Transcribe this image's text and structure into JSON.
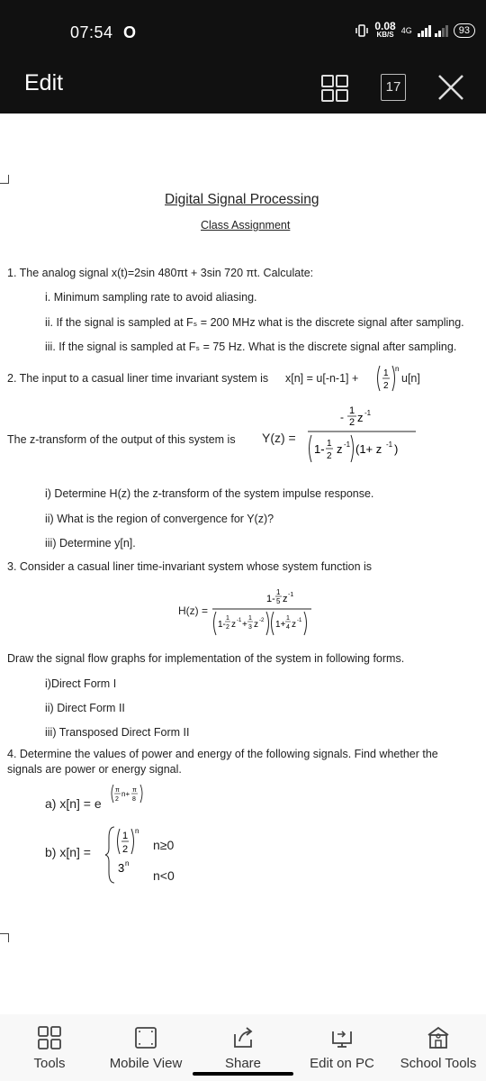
{
  "status": {
    "time": "07:54",
    "indicator": "O",
    "speed_value": "0.08",
    "speed_unit": "KB/S",
    "network": "4G",
    "battery": "93"
  },
  "topbar": {
    "title": "Edit",
    "page_count": "17"
  },
  "doc": {
    "title": "Digital Signal Processing",
    "subtitle": "Class Assignment",
    "q1": "1. The analog signal x(t)=2sin 480πt + 3sin 720 πt. Calculate:",
    "q1i": "i. Minimum sampling rate to avoid aliasing.",
    "q1ii": "ii. If the signal is sampled at Fₛ = 200 MHz what is the discrete signal after sampling.",
    "q1iii": "iii. If the signal is sampled at Fₛ = 75 Hz. What is the discrete signal after sampling.",
    "q2": "2. The input to a casual liner time invariant system is",
    "q2_expr_a": "x[n] = u[-n-1] +",
    "q2_expr_b": "u[n]",
    "q2_z": "The z-transform of the output of this system is",
    "q2_Y": "Y(z) =",
    "q2i": "i) Determine H(z) the z-transform of the system impulse response.",
    "q2ii": "ii) What is the region of convergence for Y(z)?",
    "q2iii": "iii) Determine y[n].",
    "q3": "3. Consider a casual liner time-invariant system whose system function is",
    "q3_H": "H(z) =",
    "q3_draw": "Draw the signal flow graphs for implementation of the system in following forms.",
    "q3i": "i)Direct Form I",
    "q3ii": "ii) Direct Form II",
    "q3iii": "iii) Transposed Direct Form II",
    "q4a": "4. Determine the values of power and energy of the following signals. Find whether the",
    "q4b": "signals are power or energy signal.",
    "q4_a": "a) x[n] = e",
    "q4_b": "b) x[n] =",
    "q4_b_cond1": "n≥0",
    "q4_b_cond2": "n<0"
  },
  "bottom": {
    "tools": "Tools",
    "mobile_view": "Mobile View",
    "share": "Share",
    "edit_pc": "Edit on PC",
    "school_tools": "School Tools"
  }
}
